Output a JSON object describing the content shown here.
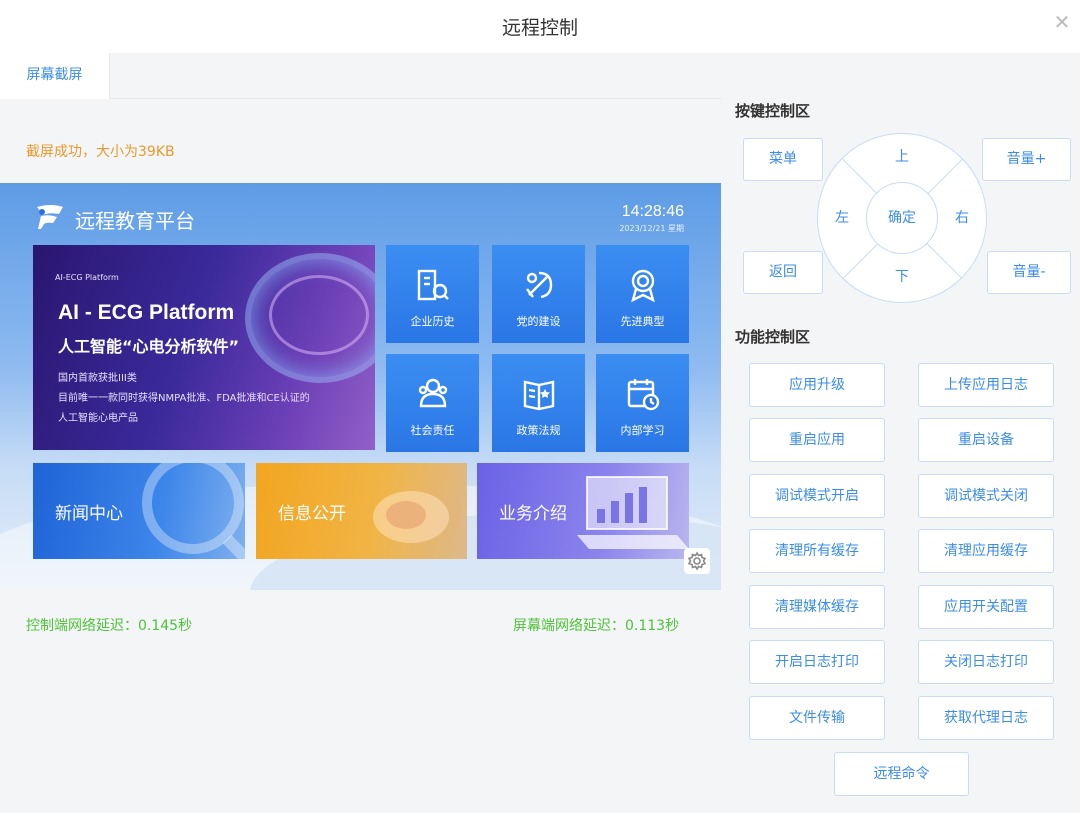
{
  "dialog": {
    "title": "远程控制"
  },
  "tabs": [
    {
      "label": "屏幕截屏"
    }
  ],
  "status": {
    "message": "截屏成功，大小为39KB"
  },
  "latency": {
    "control": "控制端网络延迟：0.145秒",
    "screen": "屏幕端网络延迟：0.113秒"
  },
  "screen": {
    "platform_title": "远程教育平台",
    "time": "14:28:46",
    "date_text": "2023/12/21  星期",
    "banner": {
      "logo_text": "AI-ECG Platform",
      "title": "AI - ECG Platform",
      "subtitle": "人工智能“心电分析软件”",
      "line1": "国内首款获批III类",
      "line2": "目前唯一一款同时获得NMPA批准、FDA批准和CE认证的",
      "line3": "人工智能心电产品"
    },
    "tiles": [
      {
        "label": "企业历史",
        "icon": "building-icon"
      },
      {
        "label": "党的建设",
        "icon": "party-emblem-icon"
      },
      {
        "label": "先进典型",
        "icon": "medal-icon"
      },
      {
        "label": "社会责任",
        "icon": "people-icon"
      },
      {
        "label": "政策法规",
        "icon": "book-icon"
      },
      {
        "label": "内部学习",
        "icon": "calendar-clock-icon"
      }
    ],
    "cards": [
      {
        "label": "新闻中心"
      },
      {
        "label": "信息公开"
      },
      {
        "label": "业务介绍"
      }
    ]
  },
  "key_control": {
    "title": "按键控制区",
    "menu": "菜单",
    "back": "返回",
    "volume_up": "音量+",
    "volume_down": "音量-",
    "up": "上",
    "down": "下",
    "left": "左",
    "right": "右",
    "ok": "确定"
  },
  "function_control": {
    "title": "功能控制区",
    "buttons": [
      "应用升级",
      "上传应用日志",
      "重启应用",
      "重启设备",
      "调试模式开启",
      "调试模式关闭",
      "清理所有缓存",
      "清理应用缓存",
      "清理媒体缓存",
      "应用开关配置",
      "开启日志打印",
      "关闭日志打印",
      "文件传输",
      "获取代理日志",
      "远程命令"
    ]
  }
}
